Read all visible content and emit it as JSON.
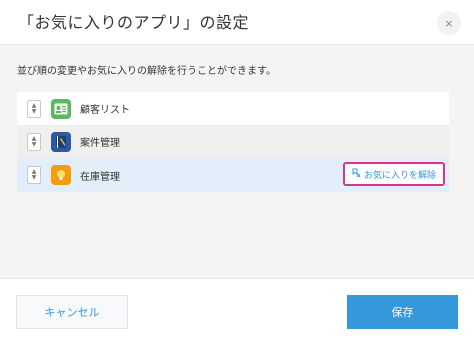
{
  "dialog": {
    "title": "「お気に入りのアプリ」の設定",
    "close_icon": "×",
    "description": "並び順の変更やお気に入りの解除を行うことができます。",
    "apps": [
      {
        "name": "顧客リスト",
        "icon": "contact-card-icon",
        "color": "#5cb85c"
      },
      {
        "name": "案件管理",
        "icon": "notebook-icon",
        "color": "#2c5aa0"
      },
      {
        "name": "在庫管理",
        "icon": "lightbulb-icon",
        "color": "#f39c12"
      }
    ],
    "unfavorite_label": "お気に入りを解除",
    "cancel_label": "キャンセル",
    "save_label": "保存"
  },
  "colors": {
    "accent": "#3498db",
    "highlight_border": "#e0318a",
    "selected_row": "#e2eef9"
  }
}
